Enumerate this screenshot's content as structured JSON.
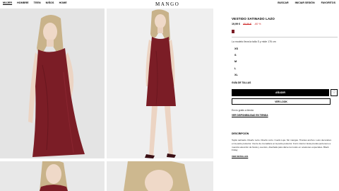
{
  "nav": {
    "left_items": [
      "MUJER",
      "HOMBRE",
      "TEEN",
      "NIÑOS",
      "HOME"
    ],
    "logo": "MANGO",
    "right_items": [
      "BUSCAR",
      "INICIAR SESIÓN",
      "FAVORITOS"
    ]
  },
  "product": {
    "title": "VESTIDO SATINADO LAZO",
    "price_current": "19,99 €",
    "price_original": "49,99 €",
    "discount": "-60 %",
    "color_hex": "#7b1d26",
    "model_info": "La modelo lleva la talla S y mide 176 cm",
    "sizes": [
      "XS",
      "S",
      "M",
      "L",
      "XL"
    ],
    "size_guide": "GUÍA DE TALLAS",
    "add_button": "AÑADIR",
    "fav_icon": "heart-icon",
    "look_button": "VER LOOK",
    "shipping": "Envío gratis a tienda",
    "availability": "VER DISPONIBILIDAD EN TIENDA",
    "description_title": "DESCRIPCIÓN",
    "description_text": "Tejido satinado. Diseño recto. Diseño corto. Cuello Loja. Sin mangas. Tirantes anchos. Lazo decorativo en la parte posterior. Cierre de cremallera en la parte posterior. Forro interior. Esta prenda pertenece a nuestra selección de fiesta y eventos, diseñada para darse tus looks en ocasiones especiales. Black Friday",
    "details_link": "VER DETALLES"
  },
  "colors": {
    "dress": "#7b1d26",
    "accent_red": "#cc2222"
  }
}
